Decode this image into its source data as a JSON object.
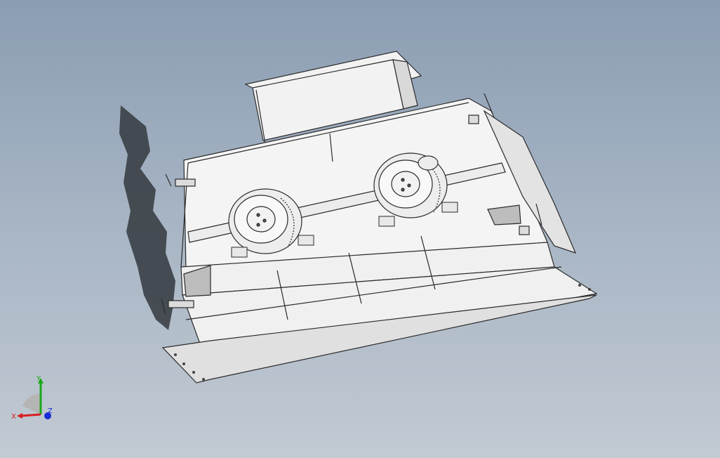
{
  "viewport": {
    "background_top": "#8b9db3",
    "background_bottom": "#c2cad3",
    "model_fill": "#f2f2f2",
    "model_edge": "#2a2a2a",
    "shadow_color": "#3a3f45"
  },
  "triad": {
    "x_label": "X",
    "y_label": "Y",
    "z_label": "Z",
    "x_color": "#d62020",
    "y_color": "#1aa81a",
    "z_color": "#1a2ad6"
  }
}
